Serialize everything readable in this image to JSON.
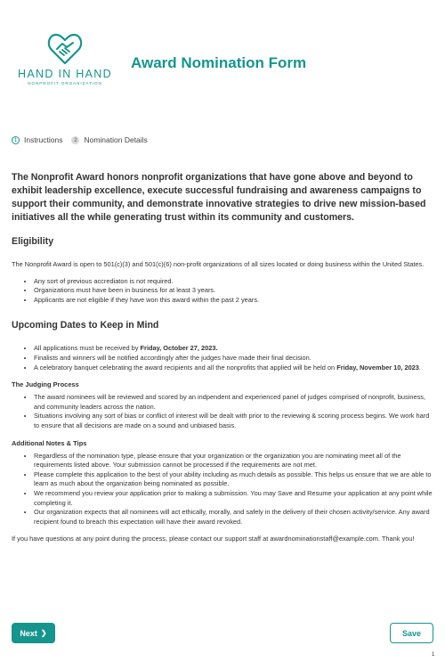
{
  "brand": {
    "name": "HAND IN HAND",
    "tagline": "NONPROFIT ORGANIZATION",
    "color": "#15958d"
  },
  "form": {
    "title": "Award Nomination Form"
  },
  "steps": [
    {
      "num": "1",
      "label": "Instructions",
      "active": true
    },
    {
      "num": "2",
      "label": "Nomination Details",
      "active": false
    }
  ],
  "intro": "The Nonprofit Award honors nonprofit organizations that have gone above and beyond to exhibit leadership excellence, execute successful fundraising and awareness campaigns to support their community, and demonstrate innovative strategies to drive new mission-based initiatives all the while generating trust within its community and customers.",
  "eligibility": {
    "heading": "Eligibility",
    "text": "The Nonprofit Award is open to 501(c)(3) and 501(c)(6) non-profit organizations of all sizes located or doing business within the United States.",
    "items": [
      "Any sort of previous accrediaton is not required.",
      "Organizations must have been in business for at least 3 years.",
      "Applicants are not eligible if they have won this award within the past 2 years."
    ]
  },
  "dates": {
    "heading": "Upcoming Dates to Keep in Mind",
    "item1_prefix": "All applications must be received by ",
    "item1_bold": "Friday, October 27, 2023.",
    "item2": "Finalists and winners will be notified accordingly after the judges have made their final decision.",
    "item3_prefix": "A celebratory banquet celebrating the award recipients and all the nonprofits that applied will be held on ",
    "item3_bold": "Friday, November 10, 2023",
    "item3_suffix": "."
  },
  "judging": {
    "heading": "The Judging Process",
    "items": [
      "The award nominees will be reviewed and scored by an indpendent and experienced panel of judges comprised of nonprofit, business, and community leaders across the nation.",
      "Situations involving any sort of bias or conflict of interest will be dealt with prior to the reviewing & scoring process begins. We work hard to ensure that all decisions are made on a sound and unbiased basis."
    ]
  },
  "notes": {
    "heading": "Additional Notes & Tips",
    "items": [
      "Regardless of the nomination type, please ensure that your organization or the organization you are nominating meet all of the requirements listed above. Your submission cannot be processed if the requirements are not met.",
      "Please complete this application to the best of your ability including as much details as possible. This helps us ensure that we are able to learn as much about the organization being nominated as possible.",
      "We recommend you review your application prior to making a submission. You may Save and Resume your application at any point while completing it.",
      "Our organization expects that all nominees will act ethically, morally, and safely in the delivery of their chosen activity/service. Any award recipient found to breach this expectation will have their award revoked."
    ]
  },
  "contact": "If you have questions at any point during the process, please contact our support staff at awardnominationstaff@example.com. Thank you!",
  "buttons": {
    "next": "Next",
    "save": "Save"
  },
  "page_number": "1"
}
